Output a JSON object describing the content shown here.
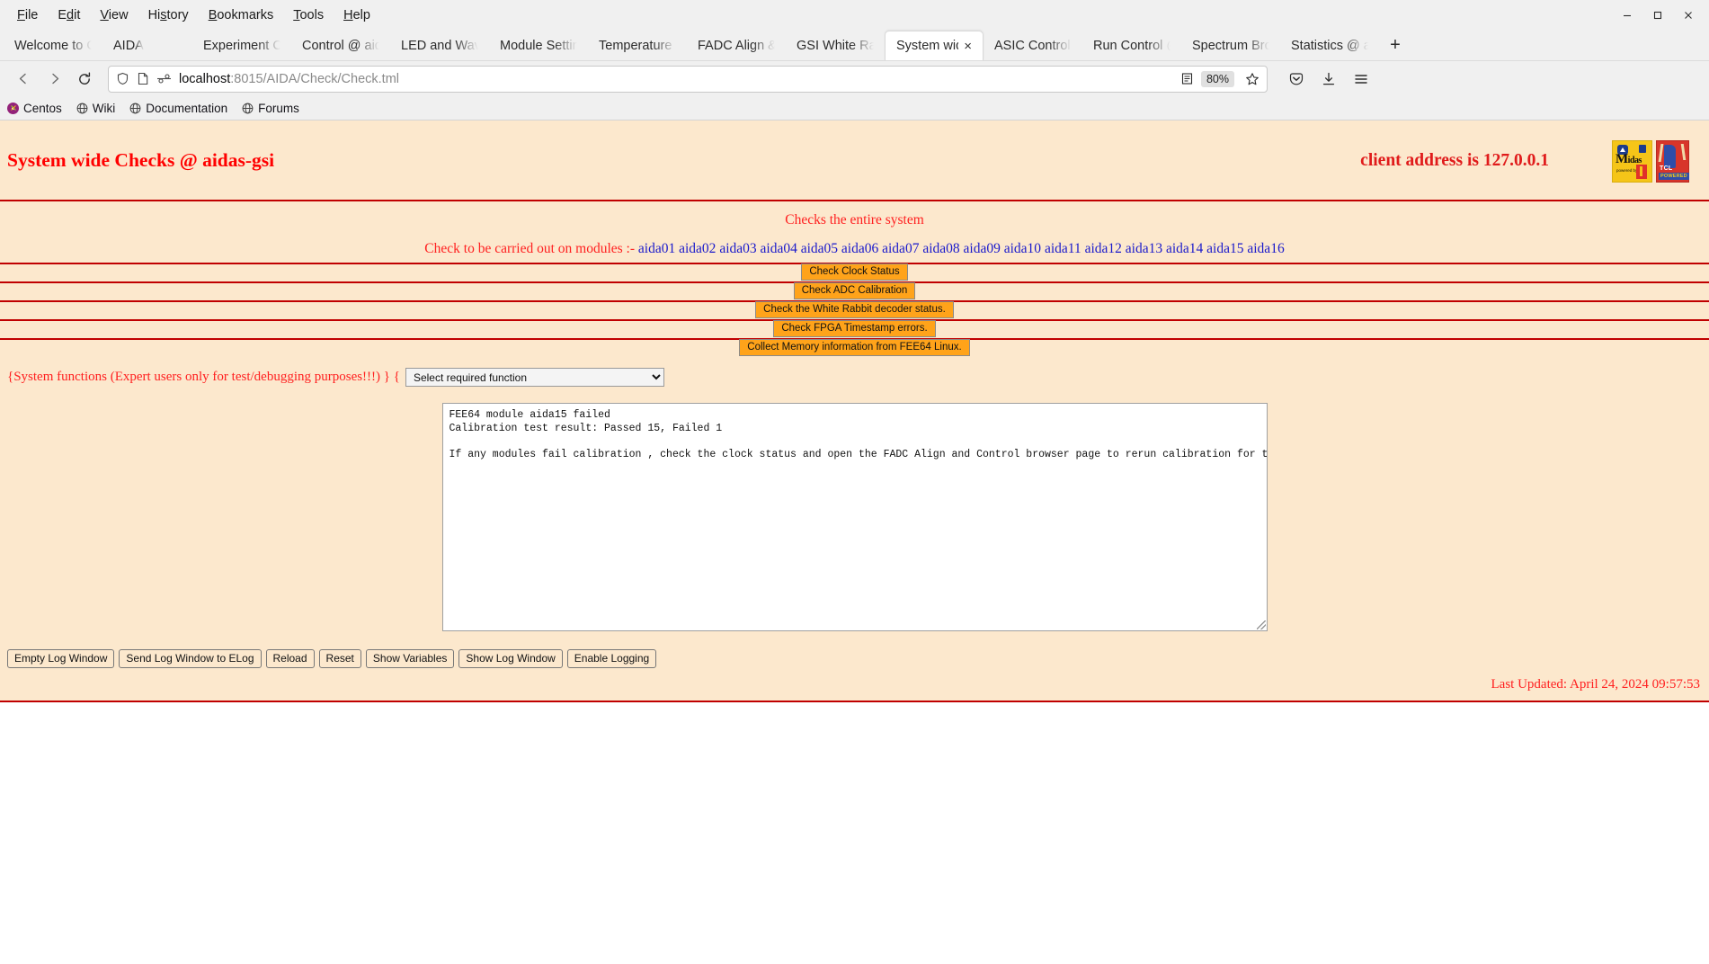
{
  "browser": {
    "menu": [
      {
        "label": "File",
        "accel": "F"
      },
      {
        "label": "Edit",
        "accel": "E"
      },
      {
        "label": "View",
        "accel": "V"
      },
      {
        "label": "History",
        "accel": "s"
      },
      {
        "label": "Bookmarks",
        "accel": "B"
      },
      {
        "label": "Tools",
        "accel": "T"
      },
      {
        "label": "Help",
        "accel": "H"
      }
    ],
    "window_controls": {
      "minimize": "minimize-icon",
      "maximize": "maximize-icon",
      "close": "close-icon"
    },
    "tabs": [
      {
        "label": "Welcome to Cent",
        "active": false
      },
      {
        "label": "AIDA",
        "active": false
      },
      {
        "label": "Experiment Contr",
        "active": false
      },
      {
        "label": "Control @ aidas-",
        "active": false
      },
      {
        "label": "LED and Wavefor",
        "active": false
      },
      {
        "label": "Module Settings ",
        "active": false
      },
      {
        "label": "Temperature and",
        "active": false
      },
      {
        "label": "FADC Align & Co",
        "active": false
      },
      {
        "label": "GSI White Rabbit",
        "active": false
      },
      {
        "label": "System wide C",
        "active": true,
        "close": "×"
      },
      {
        "label": "ASIC Control @ a",
        "active": false
      },
      {
        "label": "Run Control @ ai",
        "active": false
      },
      {
        "label": "Spectrum Browse",
        "active": false
      },
      {
        "label": "Statistics @ aidas",
        "active": false
      }
    ],
    "new_tab_label": "+",
    "nav": {
      "back": "back-arrow-icon",
      "forward": "forward-arrow-icon",
      "reload": "reload-icon"
    },
    "url": {
      "host": "localhost",
      "rest": ":8015/AIDA/Check/Check.tml",
      "full": "localhost:8015/AIDA/Check/Check.tml",
      "shield": "shield-icon",
      "page": "page-icon",
      "permissions": "permissions-icon",
      "reader": "reader-view-icon",
      "zoom_level": "80%",
      "bookmark_star": "star-icon"
    },
    "toolbar_right": {
      "pocket": "pocket-icon",
      "downloads": "download-icon",
      "menu": "hamburger-menu-icon"
    },
    "bookmarks": [
      {
        "label": "Centos",
        "icon": "centos-logo-icon"
      },
      {
        "label": "Wiki",
        "icon": "globe-icon"
      },
      {
        "label": "Documentation",
        "icon": "globe-icon"
      },
      {
        "label": "Forums",
        "icon": "globe-icon"
      }
    ]
  },
  "page": {
    "title": "System wide Checks @ aidas-gsi",
    "client_address": "client address is 127.0.0.1",
    "logos": [
      {
        "name": "midas-logo",
        "text": "idas",
        "sub": "powered by"
      },
      {
        "name": "tcl-powered-logo",
        "text": "TCL",
        "sub": "POWERED"
      }
    ],
    "subtitle": "Checks the entire system",
    "modules_prefix": "Check to be carried out on modules :-",
    "modules": [
      "aida01",
      "aida02",
      "aida03",
      "aida04",
      "aida05",
      "aida06",
      "aida07",
      "aida08",
      "aida09",
      "aida10",
      "aida11",
      "aida12",
      "aida13",
      "aida14",
      "aida15",
      "aida16"
    ],
    "check_buttons": [
      "Check Clock Status",
      "Check ADC Calibration",
      "Check the White Rabbit decoder status.",
      "Check FPGA Timestamp errors.",
      "Collect Memory information from FEE64 Linux."
    ],
    "sysfunc": {
      "label_left": "{System functions (Expert users only for test/debugging purposes!!!)  }  {",
      "select_value": "Select required function",
      "options": [
        "Select required function"
      ]
    },
    "log_text": "FEE64 module aida15 failed\nCalibration test result: Passed 15, Failed 1\n\nIf any modules fail calibration , check the clock status and open the FADC Align and Control browser page to rerun calibration for that module",
    "bottom_buttons": [
      "Empty Log Window",
      "Send Log Window to ELog",
      "Reload",
      "Reset",
      "Show Variables",
      "Show Log Window",
      "Enable Logging"
    ],
    "last_updated": "Last Updated: April 24, 2024 09:57:53",
    "colors": {
      "page_bg": "#fce8cd",
      "accent_red": "#ff2020",
      "title_red": "#ff0000",
      "rule_red": "#c00000",
      "link_blue": "#1a1acc",
      "button_orange": "#ffa31a"
    }
  }
}
